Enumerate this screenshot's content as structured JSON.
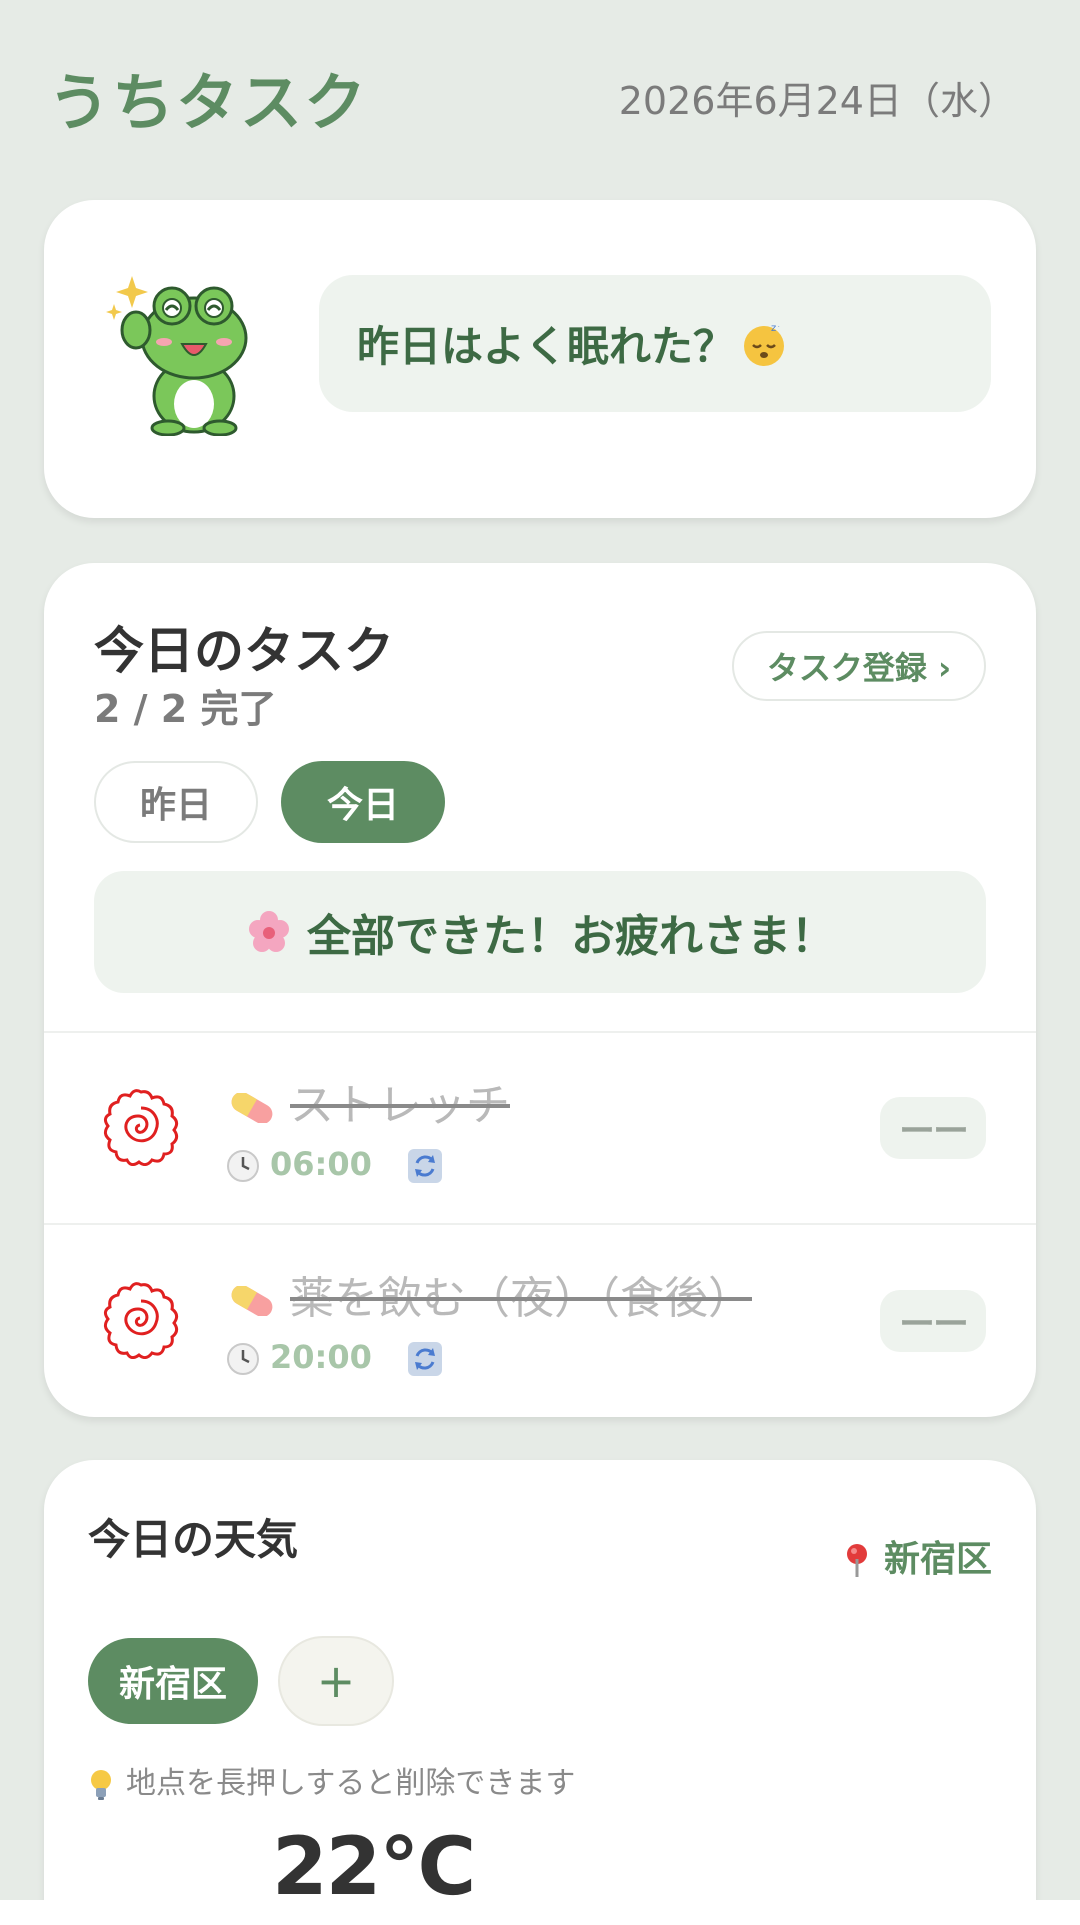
{
  "header": {
    "title": "うちタスク",
    "date": "2026年6月24日（水）"
  },
  "greeting": {
    "message": "昨日はよく眠れた？"
  },
  "tasks": {
    "title": "今日のタスク",
    "progress": "2 / 2 完了",
    "register_label": "タスク登録 ›",
    "tabs": [
      {
        "label": "昨日",
        "selected": false
      },
      {
        "label": "今日",
        "selected": true
      }
    ],
    "done_message": "全部できた！お疲れさま！",
    "items": [
      {
        "name": "ストレッチ",
        "time": "06:00",
        "status": "ーー",
        "done": true
      },
      {
        "name": "薬を飲む（夜）（食後）",
        "time": "20:00",
        "status": "ーー",
        "done": true
      }
    ]
  },
  "weather": {
    "title": "今日の天気",
    "location": "新宿区",
    "chips": [
      {
        "label": "新宿区"
      }
    ],
    "add_label": "+",
    "hint": "地点を長押しすると削除できます",
    "temperature": "22℃"
  },
  "colors": {
    "accent": "#5d8c62",
    "background": "#e6ebe6",
    "card": "#ffffff",
    "spiral": "#e02020"
  },
  "icons": [
    "frog-mascot",
    "sleeping-face-icon",
    "flower-icon",
    "spiral-done-icon",
    "pill-icon",
    "clock-icon",
    "repeat-icon",
    "pin-icon",
    "bulb-icon"
  ]
}
